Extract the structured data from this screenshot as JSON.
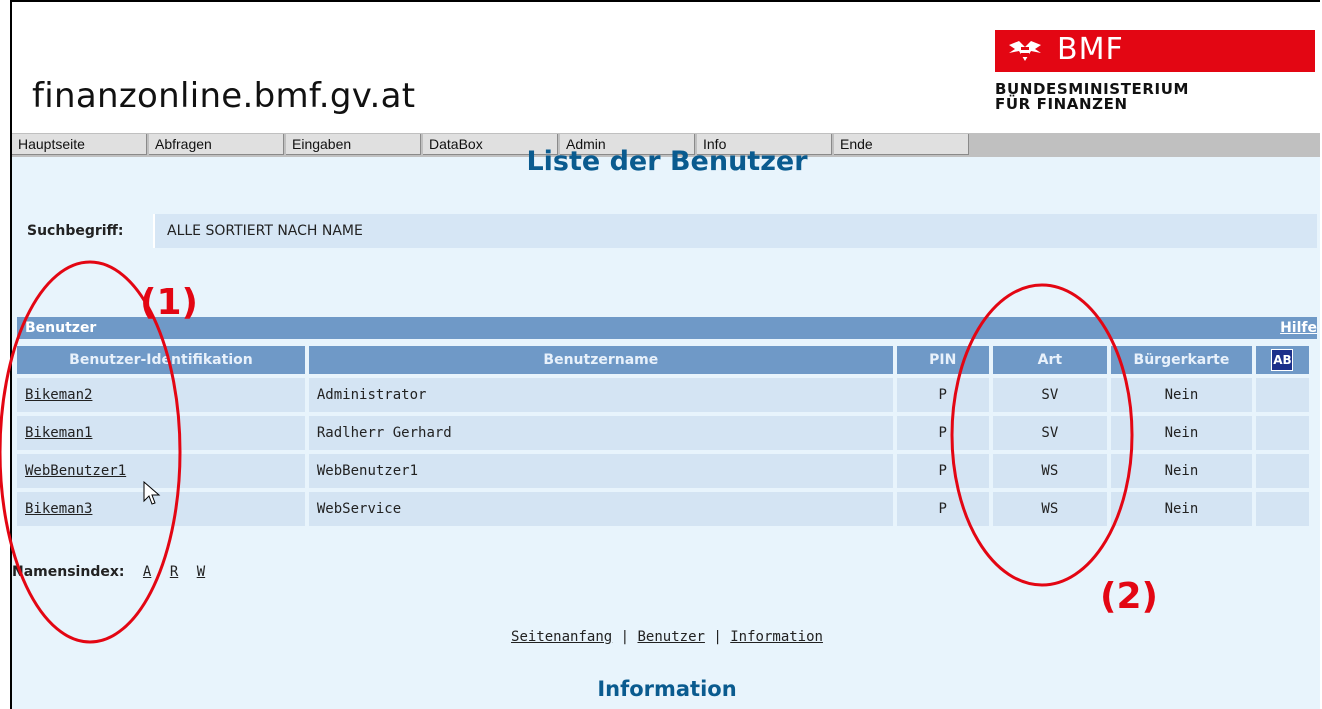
{
  "header": {
    "site_title": "finanzonline.bmf.gv.at",
    "logo_text": "BMF",
    "ministry_line1": "BUNDESMINISTERIUM",
    "ministry_line2": "FÜR FINANZEN"
  },
  "menu": [
    "Hauptseite",
    "Abfragen",
    "Eingaben",
    "DataBox",
    "Admin",
    "Info",
    "Ende"
  ],
  "page_title": "Liste der Benutzer",
  "search": {
    "label": "Suchbegriff:",
    "value": "ALLE SORTIERT NACH NAME"
  },
  "section": {
    "label": "Benutzer",
    "help": "Hilfe"
  },
  "table": {
    "headers": [
      "Benutzer-Identifikation",
      "Benutzername",
      "PIN",
      "Art",
      "Bürgerkarte"
    ],
    "rows": [
      {
        "id": "Bikeman2",
        "name": "Administrator",
        "pin": "P",
        "art": "SV",
        "buergerkarte": "Nein"
      },
      {
        "id": "Bikeman1",
        "name": "Radlherr Gerhard",
        "pin": "P",
        "art": "SV",
        "buergerkarte": "Nein"
      },
      {
        "id": "WebBenutzer1",
        "name": "WebBenutzer1",
        "pin": "P",
        "art": "WS",
        "buergerkarte": "Nein"
      },
      {
        "id": "Bikeman3",
        "name": "WebService",
        "pin": "P",
        "art": "WS",
        "buergerkarte": "Nein"
      }
    ],
    "sort_icon_text": "AB"
  },
  "name_index": {
    "label": "Namensindex:",
    "letters": [
      "A",
      "R",
      "W"
    ]
  },
  "footer": {
    "links": [
      "Seitenanfang",
      "Benutzer",
      "Information"
    ],
    "separator": "|"
  },
  "info_heading": "Information",
  "annotations": {
    "label1": "(1)",
    "label2": "(2)",
    "color": "#e30613"
  },
  "colors": {
    "header_blue": "#6f99c7",
    "cell_blue": "#d4e4f3",
    "title_blue": "#0a5b8f",
    "brand_red": "#e30613"
  }
}
